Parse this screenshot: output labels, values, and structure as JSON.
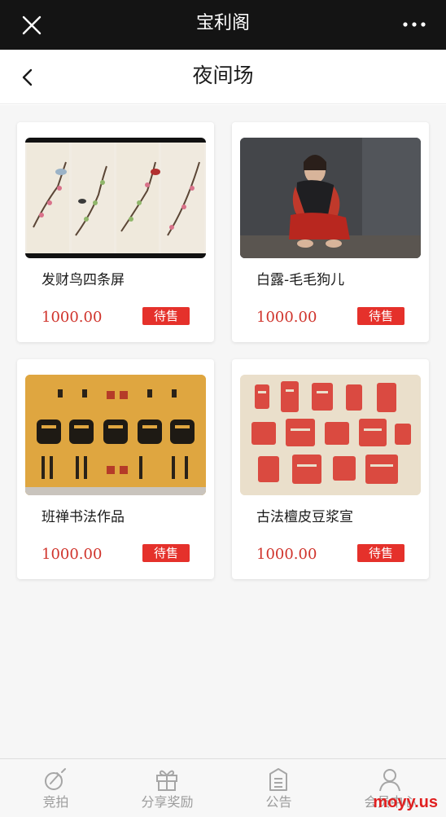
{
  "app": {
    "window_title": "宝利阁",
    "page_title": "夜间场"
  },
  "colors": {
    "topbar": "#141414",
    "price": "#d0342c",
    "badge": "#e5312b",
    "tab_label": "#9c9c9c"
  },
  "products": [
    {
      "name": "发财鸟四条屏",
      "price": "1000.00",
      "status": "待售",
      "image": "bird-plum-blossom-four-panel-painting"
    },
    {
      "name": "白露-毛毛狗儿",
      "price": "1000.00",
      "status": "待售",
      "image": "woman-in-red-portrait-painting"
    },
    {
      "name": "班禅书法作品",
      "price": "1000.00",
      "status": "待售",
      "image": "buddha-calligraphy-scroll"
    },
    {
      "name": "古法檀皮豆浆宣",
      "price": "1000.00",
      "status": "待售",
      "image": "red-calligraphy-on-rice-paper"
    }
  ],
  "tabs": [
    {
      "label": "竞拍",
      "icon": "auction-icon"
    },
    {
      "label": "分享奖励",
      "icon": "gift-icon"
    },
    {
      "label": "公告",
      "icon": "notice-icon"
    },
    {
      "label": "会员中心",
      "icon": "member-icon"
    }
  ],
  "watermark": "moyy.us"
}
